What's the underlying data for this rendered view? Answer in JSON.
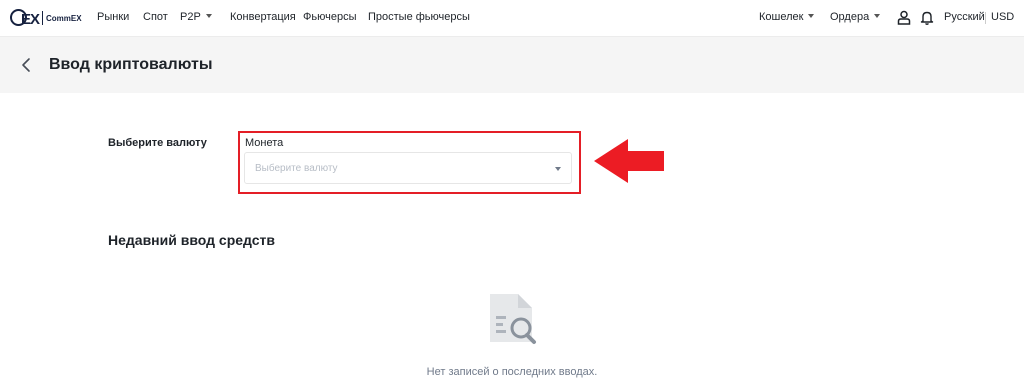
{
  "brand": {
    "logo_text": "CommEX"
  },
  "nav": {
    "markets": "Рынки",
    "spot": "Спот",
    "p2p": "P2P",
    "convert": "Конвертация",
    "futures": "Фьючерсы",
    "simple_futures": "Простые фьючерсы"
  },
  "topright": {
    "wallet": "Кошелек",
    "orders": "Ордера",
    "language": "Русский",
    "currency": "USD"
  },
  "page": {
    "title": "Ввод криптовалюты"
  },
  "form": {
    "select_currency_label": "Выберите валюту",
    "coin_label": "Монета",
    "coin_placeholder": "Выберите валюту"
  },
  "recent": {
    "title": "Недавний ввод средств",
    "empty_text": "Нет записей о последних вводах."
  },
  "colors": {
    "highlight": "#e41e26",
    "text": "#1e2329",
    "muted": "#707a8a"
  },
  "icons": [
    "user-icon",
    "bell-icon",
    "back-arrow-icon",
    "empty-records-icon",
    "annotation-arrow"
  ]
}
